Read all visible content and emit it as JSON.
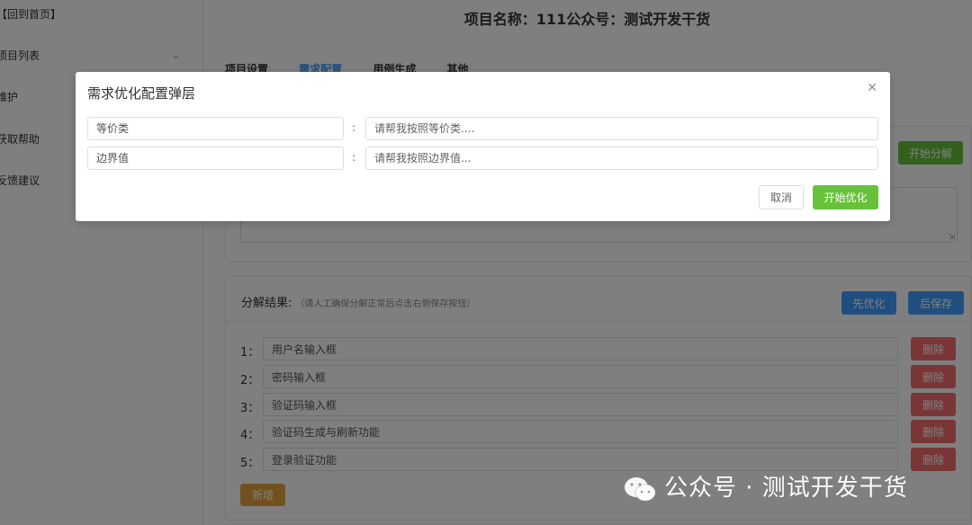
{
  "sidebar": {
    "items": [
      {
        "label": "【回到首页】"
      },
      {
        "label": "项目列表"
      },
      {
        "label": "维护"
      },
      {
        "label": "获取帮助"
      },
      {
        "label": "反馈建议"
      }
    ]
  },
  "header": {
    "title": "项目名称：111公众号：测试开发干货"
  },
  "tabs": [
    {
      "label": "项目设置"
    },
    {
      "label": "需求配置"
    },
    {
      "label": "用例生成"
    },
    {
      "label": "其他"
    }
  ],
  "requirement_panel": {
    "start_decompose_label": "开始分解"
  },
  "results": {
    "title": "分解结果:",
    "hint": "（请人工确保分解正常后点击右侧保存按钮）",
    "optimize_first_label": "先优化",
    "save_later_label": "后保存",
    "delete_label": "删除",
    "add_label": "新增",
    "rows": [
      {
        "num": "1：",
        "value": "用户名输入框"
      },
      {
        "num": "2：",
        "value": "密码输入框"
      },
      {
        "num": "3：",
        "value": "验证码输入框"
      },
      {
        "num": "4：",
        "value": "验证码生成与刷新功能"
      },
      {
        "num": "5：",
        "value": "登录验证功能"
      }
    ]
  },
  "modal": {
    "title": "需求优化配置弹层",
    "fields": [
      {
        "label": "等价类",
        "placeholder": "请帮我按照等价类...."
      },
      {
        "label": "边界值",
        "placeholder": "请帮我按照边界值..."
      }
    ],
    "colon": ":",
    "cancel_label": "取消",
    "confirm_label": "开始优化"
  },
  "watermark": {
    "text": "公众号 · 测试开发干货"
  },
  "icons": {
    "close": "close-icon",
    "chevron": "chevron-down-icon",
    "wechat": "wechat-icon"
  }
}
